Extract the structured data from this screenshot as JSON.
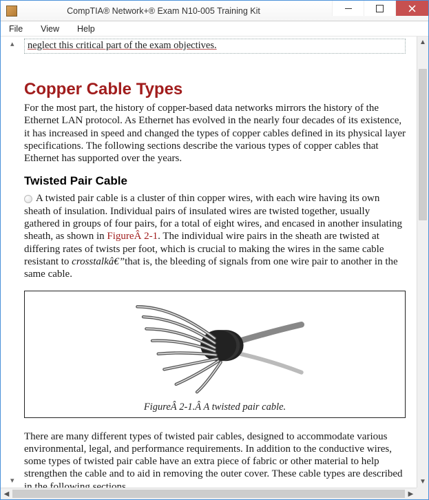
{
  "window": {
    "title": "CompTIA® Network+® Exam N10-005 Training Kit"
  },
  "menu": {
    "file": "File",
    "view": "View",
    "help": "Help"
  },
  "nav": {
    "up": "▴",
    "down": "▾"
  },
  "doc": {
    "truncated_line": "neglect this critical part of the exam objectives.",
    "h1": "Copper Cable Types",
    "intro": "For the most part, the history of copper-based data networks mirrors the history of the Ethernet LAN protocol. As Ethernet has evolved in the nearly four decades of its existence, it has increased in speed and changed the types of copper cables defined in its physical layer specifications. The following sections describe the various types of copper cables that Ethernet has supported over the years.",
    "h2": "Twisted Pair Cable",
    "p2a": "A twisted pair cable is a cluster of thin copper wires, with each wire having its own sheath of insulation. Individual pairs of insulated wires are twisted together, usually gathered in groups of four pairs, for a total of eight wires, and encased in another insulating sheath, as shown in ",
    "figref": "FigureÂ 2-1",
    "p2b": ". The individual wire pairs in the sheath are twisted at differing rates of twists per foot, which is crucial to making the wires in the same cable resistant to ",
    "crosstalk": "crosstalkâ€”",
    "p2c": "that is, the bleeding of signals from one wire pair to another in the same cable.",
    "figcap": "FigureÂ 2-1.Â A twisted pair cable.",
    "p3": "There are many different types of twisted pair cables, designed to accommodate various environmental, legal, and performance requirements. In addition to the conductive wires, some types of twisted pair cable have an extra piece of fabric or other material to help strengthen the cable and to aid in removing the outer cover. These cable types are described in the following sections."
  }
}
